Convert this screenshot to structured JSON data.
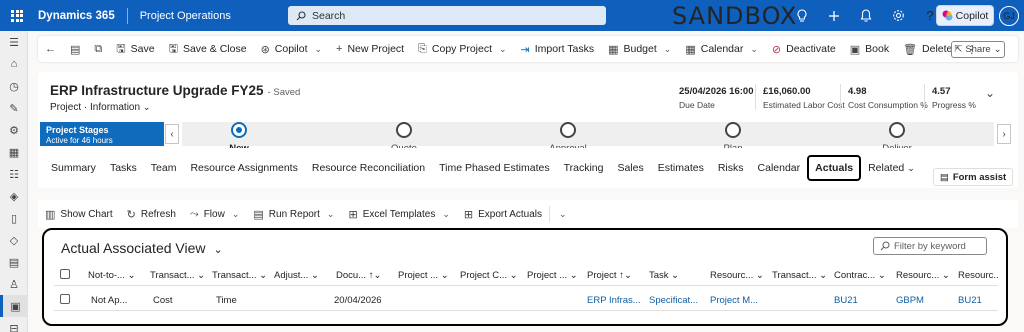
{
  "topbar": {
    "brand": "Dynamics 365",
    "app_name": "Project Operations",
    "search_placeholder": "Search",
    "sandbox_label": "SANDBOX",
    "copilot_label": "Copilot",
    "user_initials": "GJ"
  },
  "command_bar": {
    "items": [
      {
        "label": "Save"
      },
      {
        "label": "Save & Close"
      },
      {
        "label": "Copilot"
      },
      {
        "label": "New Project"
      },
      {
        "label": "Copy Project"
      },
      {
        "label": "Import Tasks"
      },
      {
        "label": "Budget"
      },
      {
        "label": "Calendar"
      },
      {
        "label": "Deactivate"
      },
      {
        "label": "Book"
      },
      {
        "label": "Delete"
      }
    ],
    "share_label": "Share"
  },
  "record": {
    "title": "ERP Infrastructure Upgrade FY25",
    "saved_status": "- Saved",
    "entity": "Project",
    "form": "Information",
    "fields": [
      {
        "value": "25/04/2026 16:00",
        "label": "Due Date"
      },
      {
        "value": "£16,060.00",
        "label": "Estimated Labor Cost"
      },
      {
        "value": "4.98",
        "label": "Cost Consumption %"
      },
      {
        "value": "4.57",
        "label": "Progress %"
      }
    ]
  },
  "bpf": {
    "label": "Project Stages",
    "duration": "Active for 46 hours",
    "stages": [
      {
        "name": "New",
        "active": true
      },
      {
        "name": "Quote",
        "active": false
      },
      {
        "name": "Approval",
        "active": false
      },
      {
        "name": "Plan",
        "active": false
      },
      {
        "name": "Deliver",
        "active": false
      }
    ]
  },
  "tabs": {
    "items": [
      "Summary",
      "Tasks",
      "Team",
      "Resource Assignments",
      "Resource Reconciliation",
      "Time Phased Estimates",
      "Tracking",
      "Sales",
      "Estimates",
      "Risks",
      "Calendar",
      "Actuals",
      "Related"
    ],
    "selected": "Actuals",
    "form_assist_label": "Form assist"
  },
  "grid_commands": {
    "items": [
      "Show Chart",
      "Refresh",
      "Flow",
      "Run Report",
      "Excel Templates",
      "Export Actuals"
    ]
  },
  "subgrid": {
    "view_name": "Actual Associated View",
    "filter_placeholder": "Filter by keyword",
    "columns": [
      "Not-to-...",
      "Transact...",
      "Transact...",
      "Adjust...",
      "Docu...",
      "Project ...",
      "Project C...",
      "Project ...",
      "Project",
      "Task",
      "Resourc...",
      "Transact...",
      "Contrac...",
      "Resourc...",
      "Resourc..."
    ],
    "sort_indicators": [
      "",
      "",
      "",
      "",
      "↑",
      "",
      "",
      "",
      "↑",
      "",
      "",
      "",
      "",
      "",
      ""
    ],
    "rows": [
      [
        "Not Ap...",
        "Cost",
        "Time",
        "",
        "20/04/2026",
        "",
        "",
        "",
        "ERP Infras...",
        "Specificat...",
        "Project M...",
        "",
        "BU21",
        "GBPM",
        "BU21"
      ]
    ]
  },
  "colors": {
    "topbar_bg": "#0f5fbd",
    "accent": "#0f6cbd",
    "link": "#115ea3"
  }
}
